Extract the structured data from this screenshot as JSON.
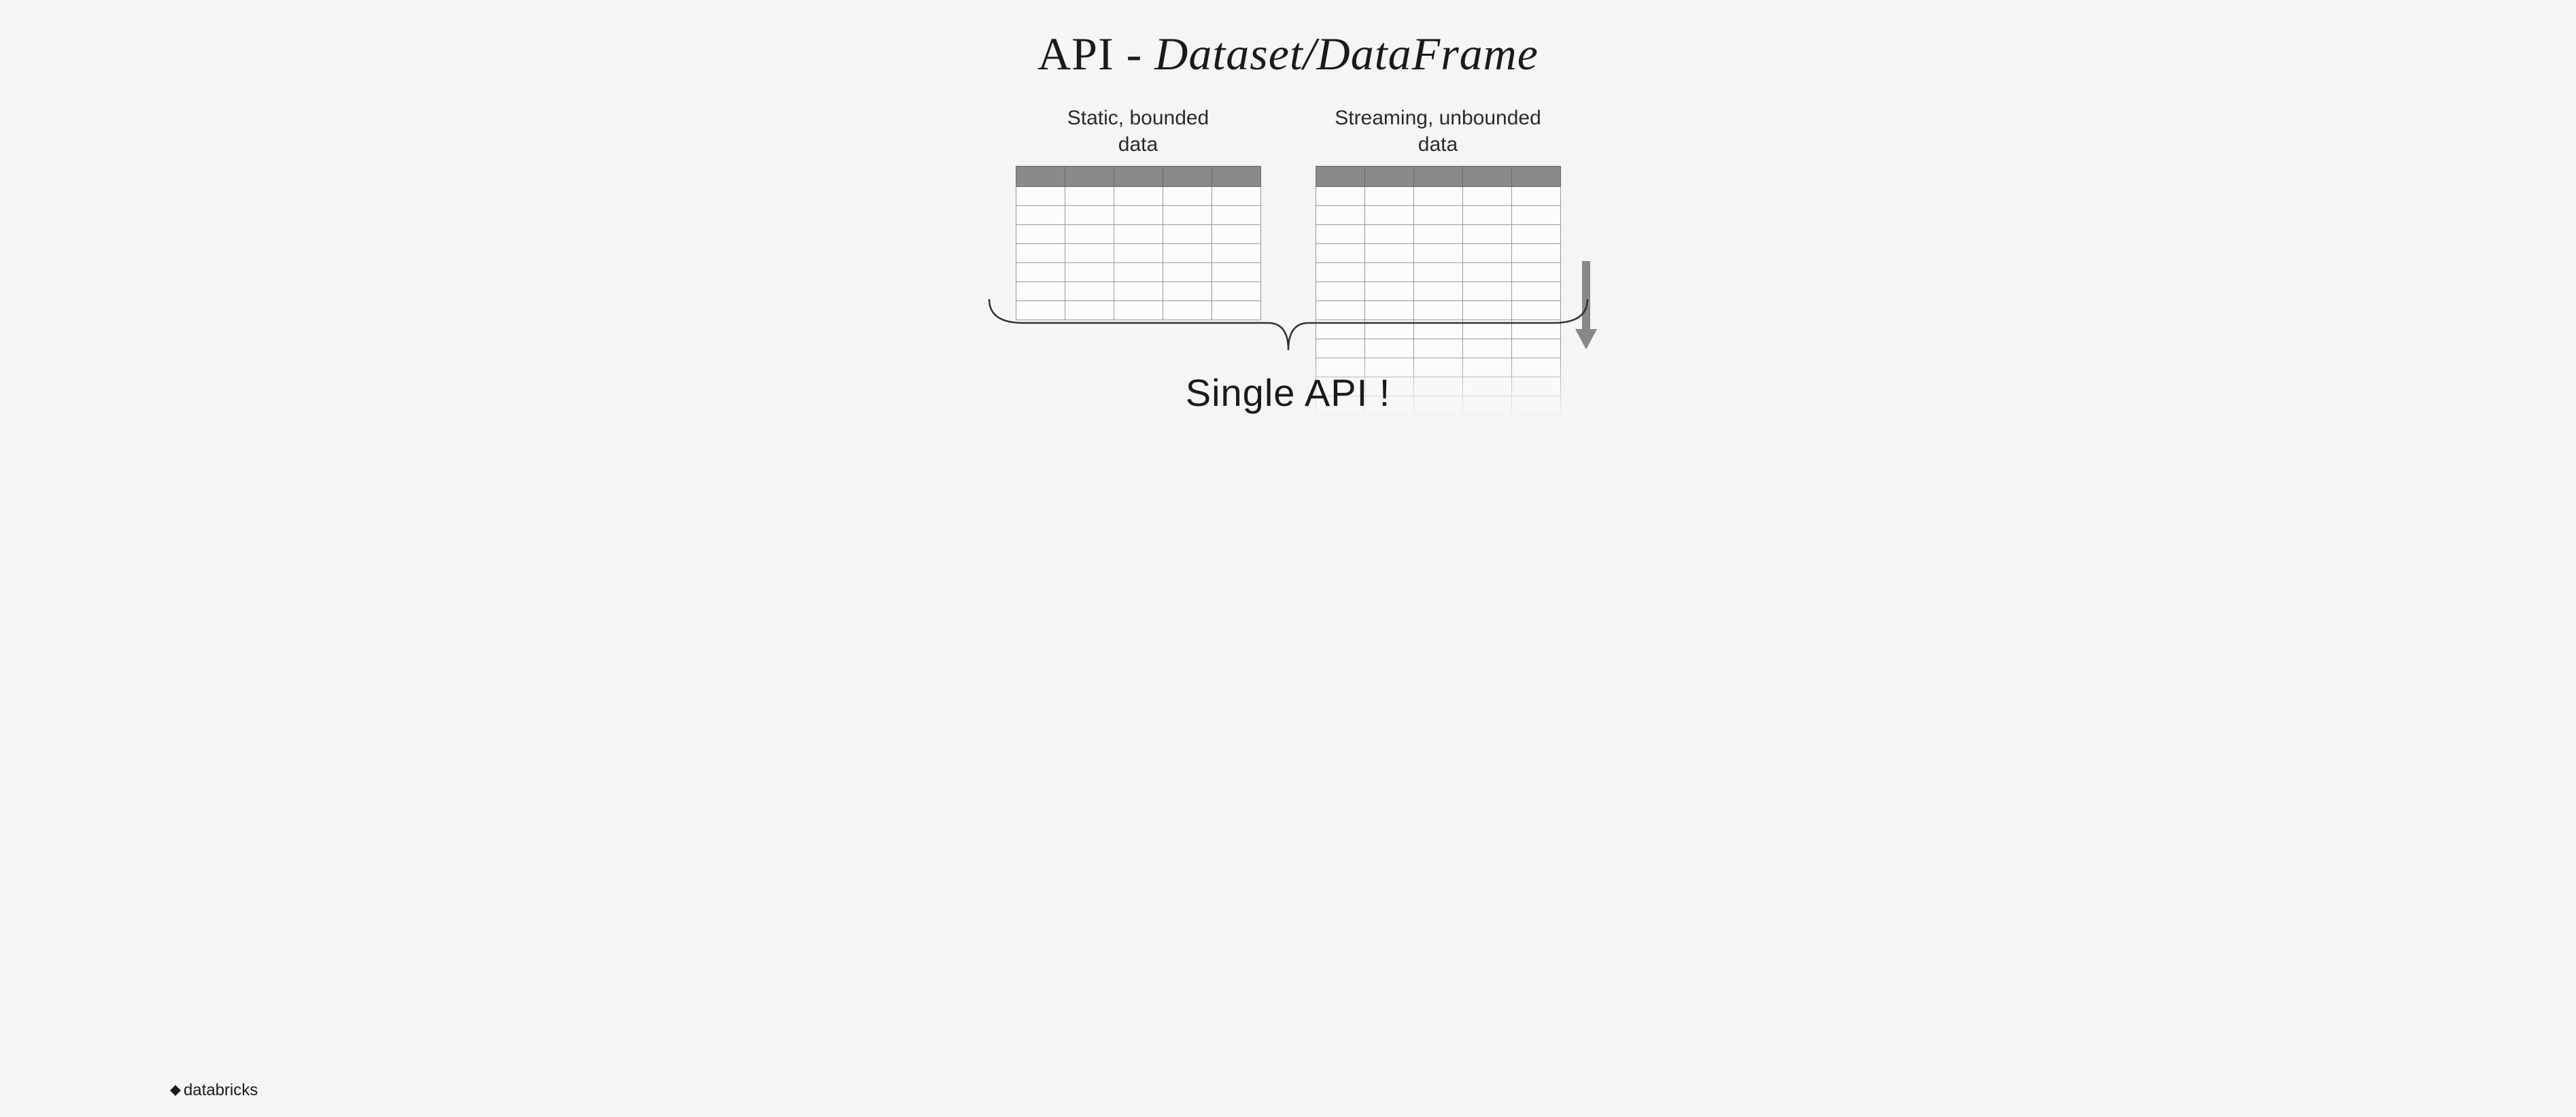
{
  "title": {
    "prefix": "API - ",
    "bold": "Dataset/DataFrame"
  },
  "left_table": {
    "label_line1": "Static, bounded",
    "label_line2": "data",
    "columns": 5,
    "rows": 7
  },
  "right_table": {
    "label_line1": "Streaming, unbounded",
    "label_line2": "data",
    "columns": 5,
    "rows": 12
  },
  "bottom_caption": "Single API !",
  "logo_text": "databricks"
}
